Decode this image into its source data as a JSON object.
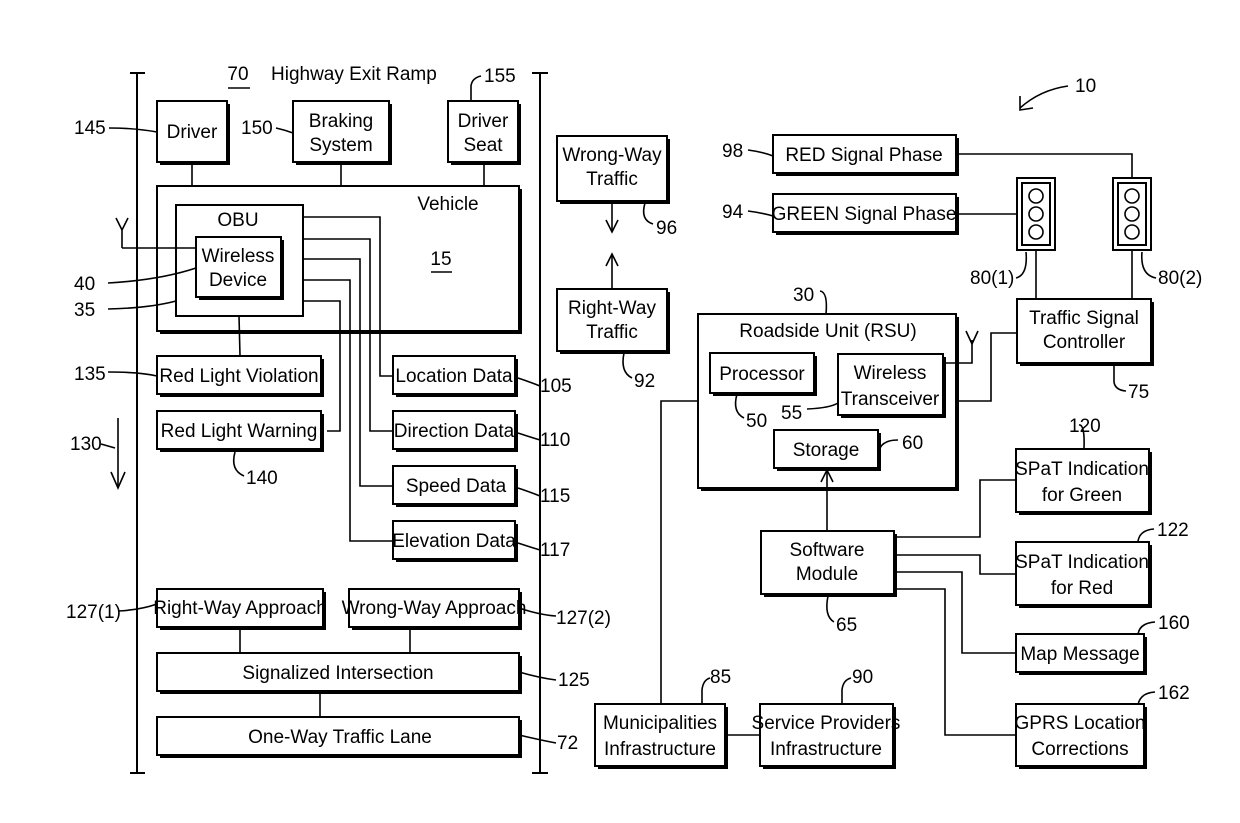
{
  "figure": {
    "reference": "10",
    "region": {
      "ref": "70",
      "title": "Highway Exit Ramp"
    },
    "vehicle": {
      "title": "Vehicle",
      "ref": "15"
    },
    "obu": {
      "title": "OBU",
      "ref": "35"
    },
    "wireless_device": {
      "line1": "Wireless",
      "line2": "Device",
      "ref": "40"
    },
    "driver": {
      "label": "Driver",
      "ref": "145"
    },
    "braking_system": {
      "line1": "Braking",
      "line2": "System",
      "ref": "150"
    },
    "driver_seat": {
      "line1": "Driver",
      "line2": "Seat",
      "ref": "155"
    },
    "red_light_violation": {
      "label": "Red Light Violation",
      "ref": "135"
    },
    "red_light_warning": {
      "label": "Red Light Warning",
      "ref": "140"
    },
    "direction_arrow": {
      "ref": "130"
    },
    "location_data": {
      "label": "Location Data",
      "ref": "105"
    },
    "direction_data": {
      "label": "Direction Data",
      "ref": "110"
    },
    "speed_data": {
      "label": "Speed Data",
      "ref": "115"
    },
    "elevation_data": {
      "label": "Elevation Data",
      "ref": "117"
    },
    "right_way_approach": {
      "label": "Right-Way Approach",
      "ref": "127(1)"
    },
    "wrong_way_approach": {
      "label": "Wrong-Way Approach",
      "ref": "127(2)"
    },
    "signalized_intersection": {
      "label": "Signalized Intersection",
      "ref": "125"
    },
    "one_way_lane": {
      "label": "One-Way Traffic Lane",
      "ref": "72"
    },
    "wrong_way_traffic": {
      "line1": "Wrong-Way",
      "line2": "Traffic",
      "ref": "96"
    },
    "right_way_traffic": {
      "line1": "Right-Way",
      "line2": "Traffic",
      "ref": "92"
    },
    "red_signal_phase": {
      "label": "RED Signal Phase",
      "ref": "98"
    },
    "green_signal_phase": {
      "label": "GREEN Signal Phase",
      "ref": "94"
    },
    "traffic_light_1": {
      "ref": "80(1)"
    },
    "traffic_light_2": {
      "ref": "80(2)"
    },
    "traffic_signal_controller": {
      "line1": "Traffic Signal",
      "line2": "Controller",
      "ref": "75"
    },
    "rsu": {
      "title": "Roadside Unit (RSU)",
      "ref": "30"
    },
    "processor": {
      "label": "Processor",
      "ref": "50"
    },
    "wireless_transceiver": {
      "line1": "Wireless",
      "line2": "Transceiver",
      "ref": "55"
    },
    "storage": {
      "label": "Storage",
      "ref": "60"
    },
    "software_module": {
      "line1": "Software",
      "line2": "Module",
      "ref": "65"
    },
    "spat_green": {
      "line1": "SPaT Indication",
      "line2": "for Green",
      "ref": "120"
    },
    "spat_red": {
      "line1": "SPaT Indication",
      "line2": "for Red",
      "ref": "122"
    },
    "map_message": {
      "label": "Map Message",
      "ref": "160"
    },
    "gprs": {
      "line1": "GPRS Location",
      "line2": "Corrections",
      "ref": "162"
    },
    "municipalities": {
      "line1": "Municipalities",
      "line2": "Infrastructure",
      "ref": "85"
    },
    "service_providers": {
      "line1": "Service Providers",
      "line2": "Infrastructure",
      "ref": "90"
    }
  }
}
